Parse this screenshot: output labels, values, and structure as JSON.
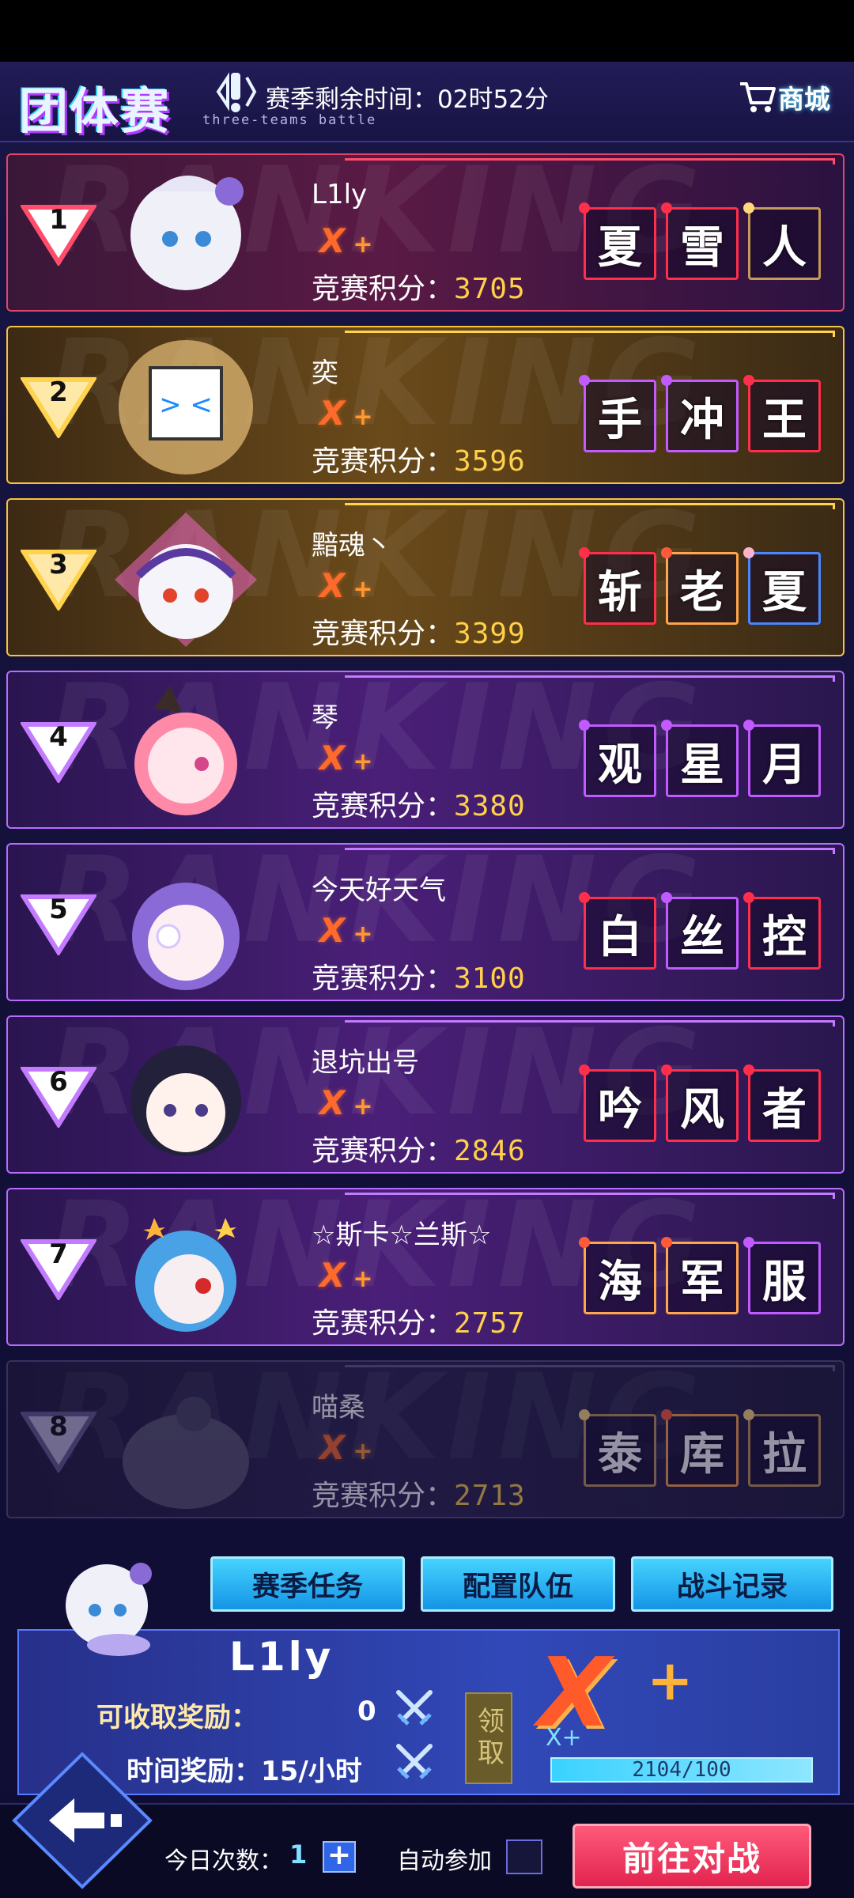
{
  "header": {
    "title": "团体赛",
    "subtitle": "three-teams battle",
    "season_label": "赛季剩余时间：02时52分",
    "shop_label": "商城"
  },
  "score_prefix": "竞赛积分：",
  "ranking": [
    {
      "rank": "1",
      "name": "L1ly",
      "tier": "X",
      "score": "3705",
      "titles": [
        "夏",
        "雪",
        "人"
      ]
    },
    {
      "rank": "2",
      "name": "奕",
      "tier": "X",
      "score": "3596",
      "titles": [
        "手",
        "冲",
        "王"
      ]
    },
    {
      "rank": "3",
      "name": "黯魂丶",
      "tier": "X",
      "score": "3399",
      "titles": [
        "斩",
        "老",
        "夏"
      ]
    },
    {
      "rank": "4",
      "name": "琴",
      "tier": "X",
      "score": "3380",
      "titles": [
        "观",
        "星",
        "月"
      ]
    },
    {
      "rank": "5",
      "name": "今天好天气",
      "tier": "X",
      "score": "3100",
      "titles": [
        "白",
        "丝",
        "控"
      ]
    },
    {
      "rank": "6",
      "name": "退坑出号",
      "tier": "X",
      "score": "2846",
      "titles": [
        "吟",
        "风",
        "者"
      ]
    },
    {
      "rank": "7",
      "name": "☆斯卡☆兰斯☆",
      "tier": "X",
      "score": "2757",
      "titles": [
        "海",
        "军",
        "服"
      ]
    },
    {
      "rank": "8",
      "name": "喵桑",
      "tier": "X",
      "score": "2713",
      "titles": [
        "泰",
        "库",
        "拉"
      ]
    }
  ],
  "tabs": {
    "season_tasks": "赛季任务",
    "team_config": "配置队伍",
    "battle_log": "战斗记录"
  },
  "me": {
    "name": "L1ly",
    "claimable_label": "可收取奖励：",
    "claimable_value": "0",
    "time_reward_label": "时间奖励：15/小时",
    "claim_label": "领取",
    "tier": "X",
    "tier_plus": "+",
    "tier_small": "X+",
    "exp_text": "2104/100",
    "exp_progress": 1.0
  },
  "footer": {
    "count_label": "今日次数：",
    "count_value": "1",
    "auto_label": "自动参加",
    "go_label": "前往对战"
  },
  "colors": {
    "accent_cyan": "#45d4ff",
    "accent_red": "#e2244f",
    "gold": "#ffd04a",
    "tier_orange": "#ff6a2a"
  }
}
